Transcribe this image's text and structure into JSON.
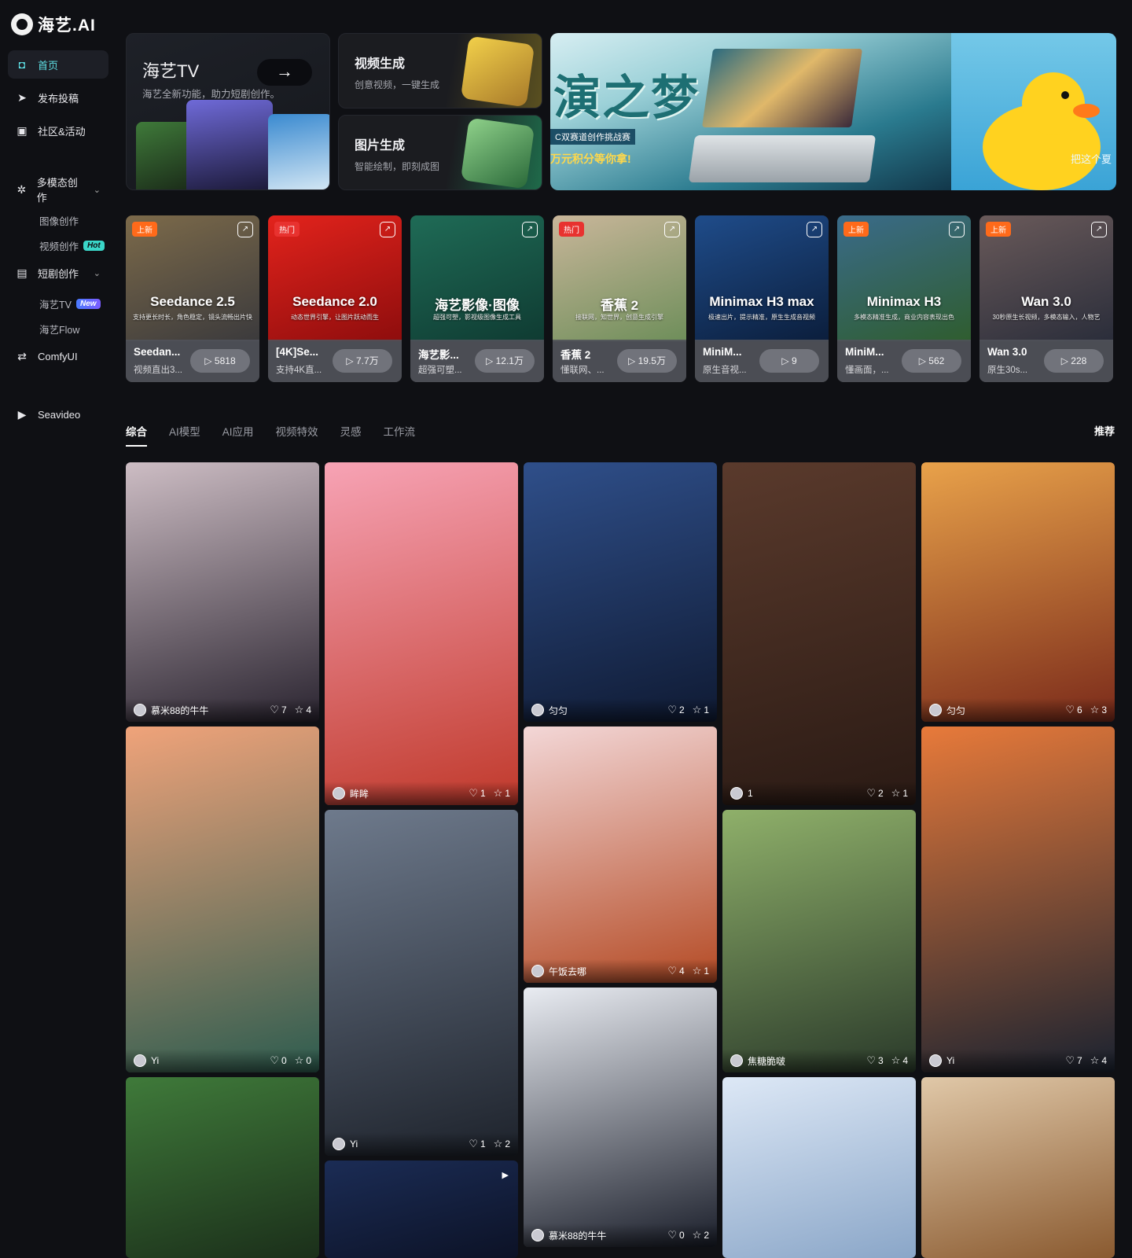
{
  "app": {
    "logo_text": "海艺.AI"
  },
  "sidebar": {
    "items": [
      {
        "label": "首页",
        "icon": "home-icon"
      },
      {
        "label": "发布投稿",
        "icon": "send-icon"
      },
      {
        "label": "社区&活动",
        "icon": "gift-icon"
      },
      {
        "label": "多模态创作",
        "icon": "sparkle-icon"
      },
      {
        "label": "短剧创作",
        "icon": "video-clip-icon"
      },
      {
        "label": "ComfyUI",
        "icon": "nodes-icon"
      },
      {
        "label": "Seavideo",
        "icon": "play-icon"
      }
    ],
    "sub_multimodal": [
      {
        "label": "图像创作"
      },
      {
        "label": "视频创作",
        "badge": "Hot"
      }
    ],
    "sub_drama": [
      {
        "label": "海艺TV",
        "badge": "New"
      },
      {
        "label": "海艺Flow"
      }
    ]
  },
  "hero": {
    "tv": {
      "title": "海艺TV",
      "subtitle": "海艺全新功能，助力短剧创作。",
      "arrow": "→"
    },
    "video_gen": {
      "title": "视频生成",
      "subtitle": "创意视频，一键生成"
    },
    "image_gen": {
      "title": "图片生成",
      "subtitle": "智能绘制，即刻成图"
    },
    "banner": {
      "title": "演之梦",
      "line1": "C双赛道创作挑战赛",
      "line2": "万元积分等你拿!",
      "right_text": "把这个夏"
    }
  },
  "models": [
    {
      "name": "Seedance 2.5",
      "desc": "支持更长时长，角色稳定，镜头流畅出片快",
      "bname": "Seedan...",
      "bsub": "视频直出3...",
      "plays": "▷ 5818",
      "tag": "上新",
      "tag_type": "new",
      "c1": "#7c6a4a",
      "c2": "#3b3a3c"
    },
    {
      "name": "Seedance 2.0",
      "desc": "动态世界引擎，让图片跃动而生",
      "bname": "[4K]Se...",
      "bsub": "支持4K直...",
      "plays": "▷ 7.7万",
      "tag": "热门",
      "tag_type": "hot",
      "c1": "#e3231c",
      "c2": "#8e0d0d"
    },
    {
      "name": "海艺影像·图像",
      "desc": "超强可塑，影视级图像生成工具",
      "bname": "海艺影...",
      "bsub": "超强可塑...",
      "plays": "▷ 12.1万",
      "tag": "",
      "tag_type": "",
      "c1": "#1f6b56",
      "c2": "#0f3b32"
    },
    {
      "name": "香蕉 2",
      "desc": "接联网，知世界，创意生成引擎",
      "bname": "香蕉 2",
      "bsub": "懂联网、...",
      "plays": "▷ 19.5万",
      "tag": "热门",
      "tag_type": "hot",
      "c1": "#c9b69a",
      "c2": "#6e8e5a"
    },
    {
      "name": "Minimax H3 max",
      "desc": "极速出片，提示精准，原生生成音视频",
      "bname": "MiniM...",
      "bsub": "原生音视...",
      "plays": "▷ 9",
      "tag": "",
      "tag_type": "",
      "c1": "#1f4c8a",
      "c2": "#0b1e3c"
    },
    {
      "name": "Minimax H3",
      "desc": "多模态精准生成，商业内容表现出色",
      "bname": "MiniM...",
      "bsub": "懂画面，...",
      "plays": "▷ 562",
      "tag": "上新",
      "tag_type": "new",
      "c1": "#3a6b8a",
      "c2": "#2f5d2f"
    },
    {
      "name": "Wan 3.0",
      "desc": "30秒原生长视频，多模态输入，人物艺",
      "bname": "Wan 3.0",
      "bsub": "原生30s...",
      "plays": "▷ 228",
      "tag": "上新",
      "tag_type": "new",
      "c1": "#6a5a5a",
      "c2": "#2a2d3a"
    }
  ],
  "tabs": [
    "综合",
    "AI模型",
    "AI应用",
    "视频特效",
    "灵感",
    "工作流"
  ],
  "sort_label": "推荐",
  "feed": [
    {
      "author": "慕米88的牛牛",
      "likes": "7",
      "stars": "4",
      "c1": "#cdbdc4",
      "c2": "#2a2430",
      "video": false
    },
    {
      "author": "Yi",
      "likes": "0",
      "stars": "0",
      "c1": "#f0a37a",
      "c2": "#2d5c4f",
      "video": false
    },
    {
      "author": "",
      "likes": "",
      "stars": "",
      "c1": "#3f7a3a",
      "c2": "#1b2f1a",
      "video": false
    },
    {
      "author": "眸眸",
      "likes": "1",
      "stars": "1",
      "c1": "#f7a3b5",
      "c2": "#c0392b",
      "video": false
    },
    {
      "author": "Yi",
      "likes": "1",
      "stars": "2",
      "c1": "#6e7a8c",
      "c2": "#1d222b",
      "video": false
    },
    {
      "author": "",
      "likes": "",
      "stars": "",
      "c1": "#1b2c55",
      "c2": "#0c1226",
      "video": true
    },
    {
      "author": "匀匀",
      "likes": "2",
      "stars": "1",
      "c1": "#2f4f8a",
      "c2": "#0f1a33",
      "video": false
    },
    {
      "author": "午饭去哪",
      "likes": "4",
      "stars": "1",
      "c1": "#f3d7d7",
      "c2": "#b44a24",
      "video": false
    },
    {
      "author": "慕米88的牛牛",
      "likes": "0",
      "stars": "2",
      "c1": "#e9ecf2",
      "c2": "#1a1e2a",
      "video": false
    },
    {
      "author": "1",
      "likes": "2",
      "stars": "1",
      "c1": "#5a3a2c",
      "c2": "#2a1a14",
      "video": false
    },
    {
      "author": "焦糖脆啵",
      "likes": "3",
      "stars": "4",
      "c1": "#8fb06a",
      "c2": "#2a3a2a",
      "video": false
    },
    {
      "author": "",
      "likes": "",
      "stars": "",
      "c1": "#dde8f6",
      "c2": "#8aa6c8",
      "video": false
    },
    {
      "author": "匀匀",
      "likes": "6",
      "stars": "3",
      "c1": "#e9a24a",
      "c2": "#7a2a1a",
      "video": false
    },
    {
      "author": "Yi",
      "likes": "7",
      "stars": "4",
      "c1": "#e87a3a",
      "c2": "#1a2230",
      "video": false
    },
    {
      "author": "",
      "likes": "",
      "stars": "",
      "c1": "#e0c8a8",
      "c2": "#8a5a30",
      "video": false
    }
  ]
}
